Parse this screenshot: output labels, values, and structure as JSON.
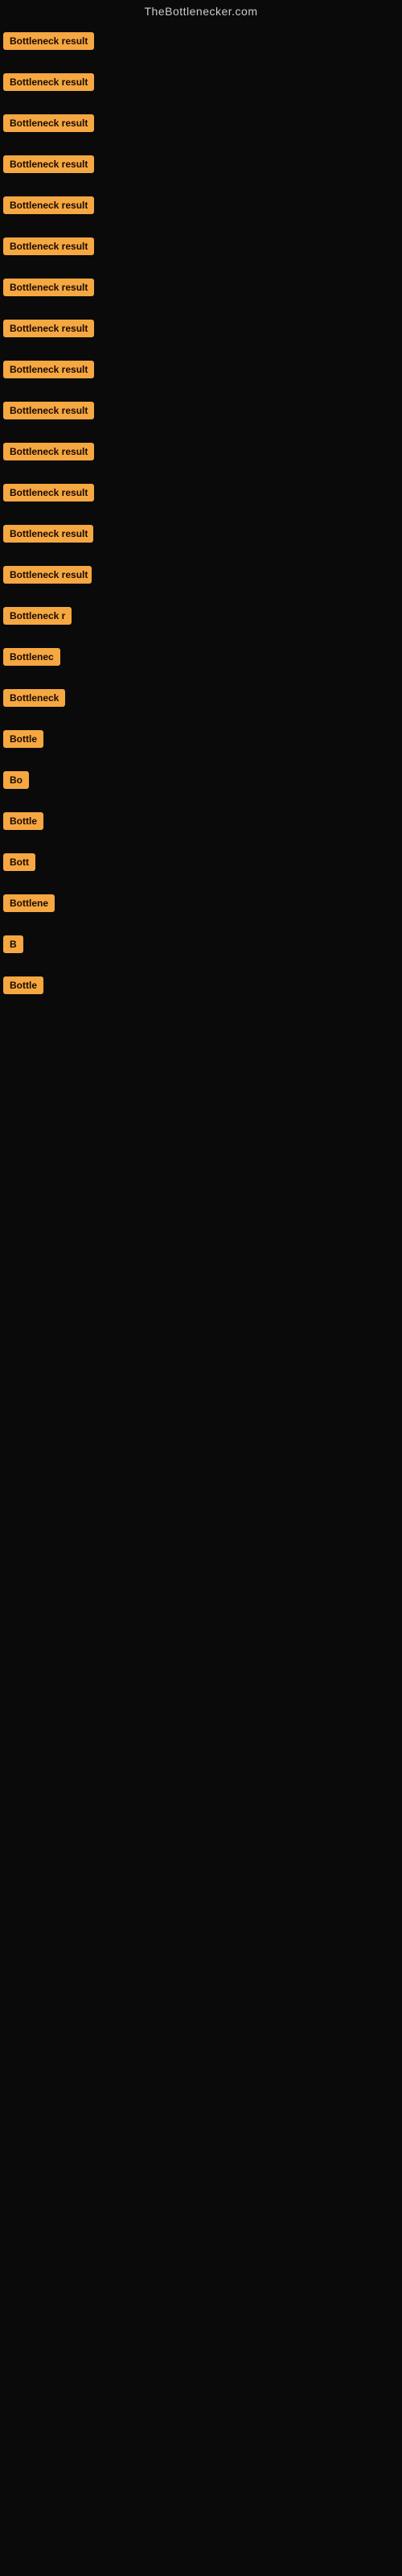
{
  "site": {
    "title": "TheBottlenecker.com"
  },
  "rows": [
    {
      "id": 1,
      "label": "Bottleneck result"
    },
    {
      "id": 2,
      "label": "Bottleneck result"
    },
    {
      "id": 3,
      "label": "Bottleneck result"
    },
    {
      "id": 4,
      "label": "Bottleneck result"
    },
    {
      "id": 5,
      "label": "Bottleneck result"
    },
    {
      "id": 6,
      "label": "Bottleneck result"
    },
    {
      "id": 7,
      "label": "Bottleneck result"
    },
    {
      "id": 8,
      "label": "Bottleneck result"
    },
    {
      "id": 9,
      "label": "Bottleneck result"
    },
    {
      "id": 10,
      "label": "Bottleneck result"
    },
    {
      "id": 11,
      "label": "Bottleneck result"
    },
    {
      "id": 12,
      "label": "Bottleneck result"
    },
    {
      "id": 13,
      "label": "Bottleneck result"
    },
    {
      "id": 14,
      "label": "Bottleneck result"
    },
    {
      "id": 15,
      "label": "Bottleneck r"
    },
    {
      "id": 16,
      "label": "Bottlenec"
    },
    {
      "id": 17,
      "label": "Bottleneck"
    },
    {
      "id": 18,
      "label": "Bottle"
    },
    {
      "id": 19,
      "label": "Bo"
    },
    {
      "id": 20,
      "label": "Bottle"
    },
    {
      "id": 21,
      "label": "Bott"
    },
    {
      "id": 22,
      "label": "Bottlene"
    },
    {
      "id": 23,
      "label": "B"
    },
    {
      "id": 24,
      "label": "Bottle"
    }
  ]
}
